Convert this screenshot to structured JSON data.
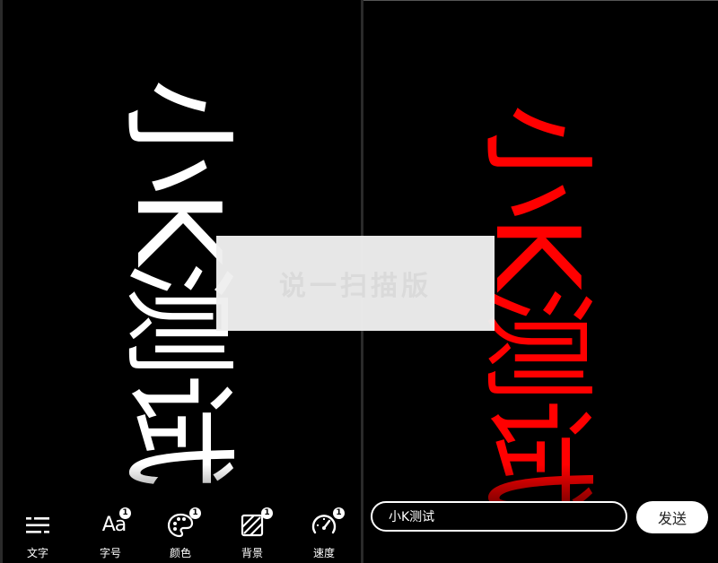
{
  "preview": {
    "left_text": "小K测试",
    "right_text": "小K测试",
    "left_color": "#ffffff",
    "right_color": "#ff0000",
    "background": "#000000"
  },
  "toolbar": {
    "items": [
      {
        "label": "文字",
        "icon": "text-align-icon",
        "badge": ""
      },
      {
        "label": "字号",
        "icon": "font-size-icon",
        "glyph": "Aa",
        "badge": "1"
      },
      {
        "label": "颜色",
        "icon": "palette-icon",
        "badge": "1"
      },
      {
        "label": "背景",
        "icon": "background-pattern-icon",
        "badge": "1"
      },
      {
        "label": "速度",
        "icon": "speedometer-icon",
        "badge": "1"
      }
    ]
  },
  "message": {
    "value": "小K测试",
    "send_label": "发送"
  },
  "watermark": {
    "text": "说一扫描版"
  }
}
